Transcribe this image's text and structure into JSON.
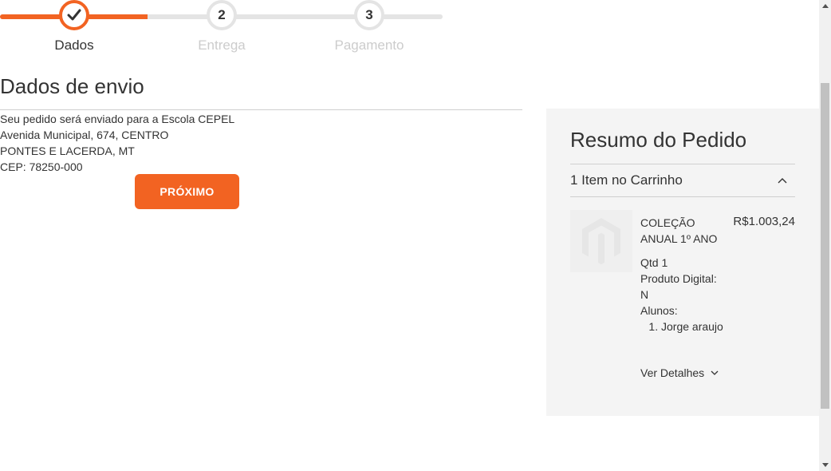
{
  "progress": {
    "steps": [
      {
        "number": "",
        "label": "Dados",
        "state": "completed"
      },
      {
        "number": "2",
        "label": "Entrega",
        "state": "pending"
      },
      {
        "number": "3",
        "label": "Pagamento",
        "state": "pending"
      }
    ],
    "fill_fraction": 0.333
  },
  "shipping": {
    "title": "Dados de envio",
    "address_lines": [
      "Seu pedido será enviado para a Escola CEPEL",
      "Avenida Municipal, 674, CENTRO",
      "PONTES E LACERDA, MT",
      "CEP: 78250-000"
    ],
    "next_label": "PRÓXIMO"
  },
  "summary": {
    "title": "Resumo do Pedido",
    "cart_count_label": "1 Item no Carrinho",
    "item": {
      "name": "COLEÇÃO ANUAL 1º ANO",
      "price": "R$1.003,24",
      "qty_line": "Qtd 1",
      "digital_line": "Produto Digital: N",
      "students_label": "Alunos:",
      "students": [
        "Jorge araujo"
      ]
    },
    "details_label": "Ver Detalhes"
  },
  "colors": {
    "accent": "#f26322",
    "summary_bg": "#f4f4f4",
    "track": "#e4e4e4"
  },
  "icons": [
    "checkmark-icon",
    "chevron-up-icon",
    "chevron-down-icon",
    "magento-logo-icon"
  ]
}
